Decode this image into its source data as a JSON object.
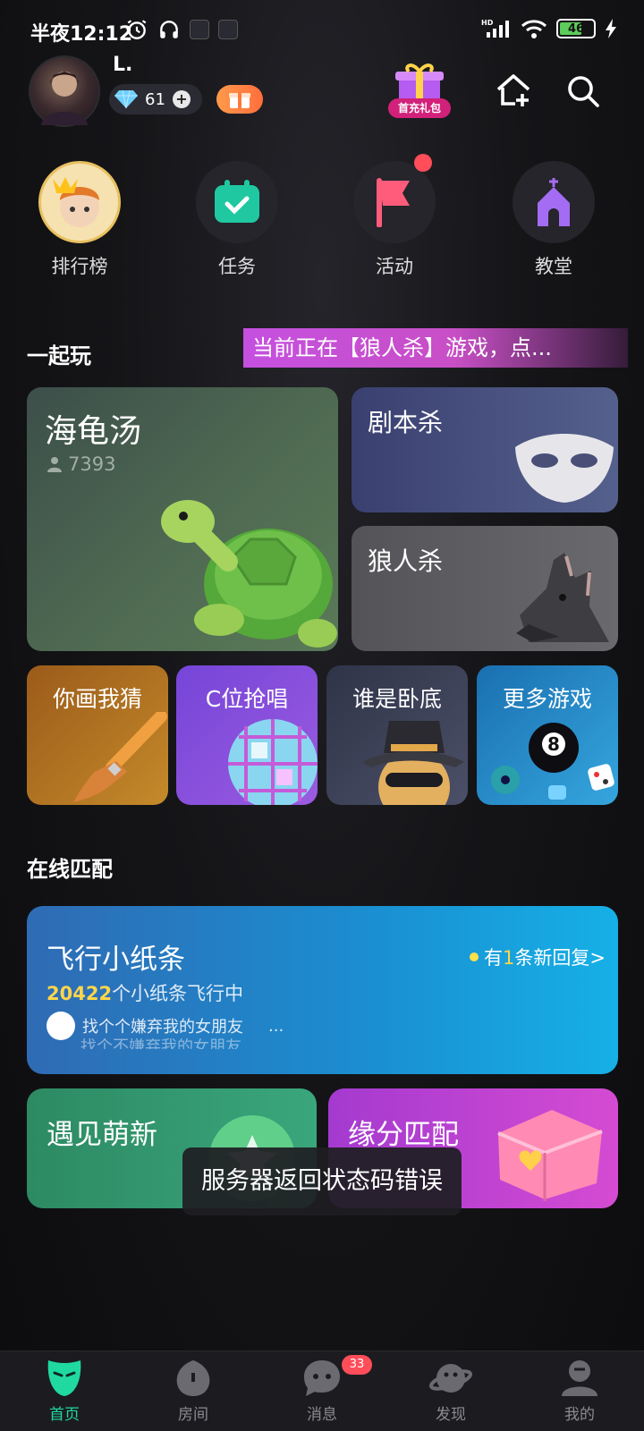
{
  "status_bar": {
    "time": "半夜12:12",
    "battery": "46",
    "network_label": "HD"
  },
  "header": {
    "username": "L.",
    "diamonds": "61",
    "first_charge_label": "首充礼包"
  },
  "quick_actions": [
    {
      "label": "排行榜"
    },
    {
      "label": "任务"
    },
    {
      "label": "活动"
    },
    {
      "label": "教堂"
    }
  ],
  "play_section": {
    "title": "一起玩",
    "ticker": "当前正在【狼人杀】游戏，点..."
  },
  "games": {
    "turtle_soup": {
      "title": "海龟汤",
      "players": "7393"
    },
    "script_kill": {
      "title": "剧本杀"
    },
    "werewolf": {
      "title": "狼人杀"
    },
    "small": [
      {
        "title": "你画我猜"
      },
      {
        "title": "C位抢唱"
      },
      {
        "title": "谁是卧底"
      },
      {
        "title": "更多游戏"
      }
    ]
  },
  "online_section": {
    "title": "在线匹配",
    "note": {
      "title": "飞行小纸条",
      "reply_prefix": "有",
      "reply_count": "1",
      "reply_suffix": "条新回复>",
      "count": "20422",
      "count_suffix": "个小纸条飞行中",
      "message_1": "找个个嫌弃我的女朋友",
      "message_more": "...",
      "message_2": "找个不嫌弃我的女朋友"
    },
    "meet_new": "遇见萌新",
    "fate_match": "缘分匹配"
  },
  "toast": "服务器返回状态码错误",
  "bottom_nav": [
    {
      "label": "首页",
      "active": true
    },
    {
      "label": "房间"
    },
    {
      "label": "消息",
      "badge": "33"
    },
    {
      "label": "发现"
    },
    {
      "label": "我的"
    }
  ],
  "colors": {
    "accent": "#20d9a0",
    "badge": "#ff4d5a",
    "highlight": "#ffd54a"
  }
}
